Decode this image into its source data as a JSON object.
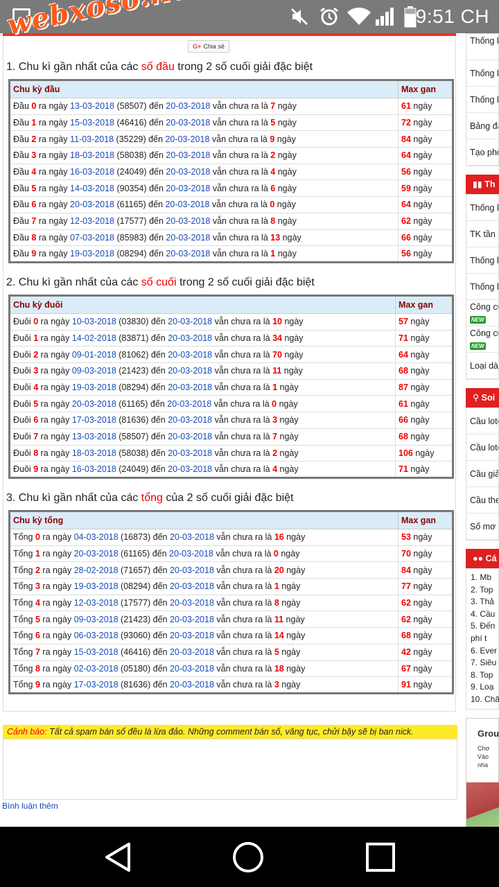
{
  "status_bar": {
    "time": "9:51 CH"
  },
  "watermark": "webxoso.net",
  "share_label": "Chia sẻ",
  "sections": [
    {
      "title_prefix": "1. Chu kì gần nhất của các ",
      "title_highlight": "số đầu",
      "title_suffix": " trong 2 số cuối giải đặc biệt",
      "col1": "Chu kỳ đầu",
      "col2": "Max gan",
      "label": "Đầu",
      "rows": [
        {
          "n": "0",
          "date": "13-03-2018",
          "code": "(58507)",
          "to": "20-03-2018",
          "days": "7",
          "max": "61"
        },
        {
          "n": "1",
          "date": "15-03-2018",
          "code": "(46416)",
          "to": "20-03-2018",
          "days": "5",
          "max": "72"
        },
        {
          "n": "2",
          "date": "11-03-2018",
          "code": "(35229)",
          "to": "20-03-2018",
          "days": "9",
          "max": "84"
        },
        {
          "n": "3",
          "date": "18-03-2018",
          "code": "(58038)",
          "to": "20-03-2018",
          "days": "2",
          "max": "64"
        },
        {
          "n": "4",
          "date": "16-03-2018",
          "code": "(24049)",
          "to": "20-03-2018",
          "days": "4",
          "max": "56"
        },
        {
          "n": "5",
          "date": "14-03-2018",
          "code": "(90354)",
          "to": "20-03-2018",
          "days": "6",
          "max": "59"
        },
        {
          "n": "6",
          "date": "20-03-2018",
          "code": "(61165)",
          "to": "20-03-2018",
          "days": "0",
          "max": "64"
        },
        {
          "n": "7",
          "date": "12-03-2018",
          "code": "(17577)",
          "to": "20-03-2018",
          "days": "8",
          "max": "62"
        },
        {
          "n": "8",
          "date": "07-03-2018",
          "code": "(85983)",
          "to": "20-03-2018",
          "days": "13",
          "max": "66"
        },
        {
          "n": "9",
          "date": "19-03-2018",
          "code": "(08294)",
          "to": "20-03-2018",
          "days": "1",
          "max": "56"
        }
      ]
    },
    {
      "title_prefix": "2. Chu kì gần nhất của các ",
      "title_highlight": "số cuối",
      "title_suffix": " trong 2 số cuối giải đặc biệt",
      "col1": "Chu kỳ đuôi",
      "col2": "Max gan",
      "label": "Đuôi",
      "rows": [
        {
          "n": "0",
          "date": "10-03-2018",
          "code": "(03830)",
          "to": "20-03-2018",
          "days": "10",
          "max": "57"
        },
        {
          "n": "1",
          "date": "14-02-2018",
          "code": "(83871)",
          "to": "20-03-2018",
          "days": "34",
          "max": "71"
        },
        {
          "n": "2",
          "date": "09-01-2018",
          "code": "(81062)",
          "to": "20-03-2018",
          "days": "70",
          "max": "64"
        },
        {
          "n": "3",
          "date": "09-03-2018",
          "code": "(21423)",
          "to": "20-03-2018",
          "days": "11",
          "max": "68"
        },
        {
          "n": "4",
          "date": "19-03-2018",
          "code": "(08294)",
          "to": "20-03-2018",
          "days": "1",
          "max": "87"
        },
        {
          "n": "5",
          "date": "20-03-2018",
          "code": "(61165)",
          "to": "20-03-2018",
          "days": "0",
          "max": "61"
        },
        {
          "n": "6",
          "date": "17-03-2018",
          "code": "(81636)",
          "to": "20-03-2018",
          "days": "3",
          "max": "66"
        },
        {
          "n": "7",
          "date": "13-03-2018",
          "code": "(58507)",
          "to": "20-03-2018",
          "days": "7",
          "max": "68"
        },
        {
          "n": "8",
          "date": "18-03-2018",
          "code": "(58038)",
          "to": "20-03-2018",
          "days": "2",
          "max": "106"
        },
        {
          "n": "9",
          "date": "16-03-2018",
          "code": "(24049)",
          "to": "20-03-2018",
          "days": "4",
          "max": "71"
        }
      ]
    },
    {
      "title_prefix": "3. Chu kì gần nhất của các ",
      "title_highlight": "tổng",
      "title_suffix": " của 2 số cuối giải đặc biệt",
      "col1": "Chu kỳ tổng",
      "col2": "Max gan",
      "label": "Tổng",
      "rows": [
        {
          "n": "0",
          "date": "04-03-2018",
          "code": "(16873)",
          "to": "20-03-2018",
          "days": "16",
          "max": "53"
        },
        {
          "n": "1",
          "date": "20-03-2018",
          "code": "(61165)",
          "to": "20-03-2018",
          "days": "0",
          "max": "70"
        },
        {
          "n": "2",
          "date": "28-02-2018",
          "code": "(71657)",
          "to": "20-03-2018",
          "days": "20",
          "max": "84"
        },
        {
          "n": "3",
          "date": "19-03-2018",
          "code": "(08294)",
          "to": "20-03-2018",
          "days": "1",
          "max": "77"
        },
        {
          "n": "4",
          "date": "12-03-2018",
          "code": "(17577)",
          "to": "20-03-2018",
          "days": "8",
          "max": "62"
        },
        {
          "n": "5",
          "date": "09-03-2018",
          "code": "(21423)",
          "to": "20-03-2018",
          "days": "11",
          "max": "62"
        },
        {
          "n": "6",
          "date": "06-03-2018",
          "code": "(93060)",
          "to": "20-03-2018",
          "days": "14",
          "max": "68"
        },
        {
          "n": "7",
          "date": "15-03-2018",
          "code": "(46416)",
          "to": "20-03-2018",
          "days": "5",
          "max": "42"
        },
        {
          "n": "8",
          "date": "02-03-2018",
          "code": "(05180)",
          "to": "20-03-2018",
          "days": "18",
          "max": "67"
        },
        {
          "n": "9",
          "date": "17-03-2018",
          "code": "(81636)",
          "to": "20-03-2018",
          "days": "3",
          "max": "91"
        }
      ]
    }
  ],
  "row_text": {
    "ra_ngay": "ra ngày",
    "den": "đến",
    "van_chua": "vẫn chưa ra là",
    "ngay": "ngày"
  },
  "warning": {
    "label": "Cảnh báo:",
    "text": " Tất cả spam bán số đều là lừa đảo. Những comment bán số, văng tục, chửi bậy sẽ bị ban nick."
  },
  "more_comments": "Bình luận thêm",
  "sidebar": {
    "group1": [
      "Thống k loto",
      "Thống k",
      "Thống k",
      "Bảng đặ",
      "Tạo phô"
    ],
    "head2": "Th",
    "group2": [
      "Thống k",
      "TK tần s",
      "Thống k",
      "Thống k",
      "Công cụ",
      "Công cụ VIP",
      "Loại dàn"
    ],
    "new_badge": "NEW",
    "head3": "Soi",
    "group3": [
      "Cầu loto",
      "Cầu loto",
      "Cầu giải",
      "Cầu theo",
      "Số mơ"
    ],
    "head4": "Cá",
    "olist": [
      "1. Mb",
      "2. Top",
      "3. Thả",
      "4. Cầu",
      "5. Đến",
      "phí t",
      "6. Ever",
      "7. Siêu",
      "8. Top",
      "9. Loạ",
      "10. Chă"
    ],
    "ad_title": "Grou",
    "ad_sub1": "Chơ",
    "ad_sub2": "Vào nha"
  }
}
